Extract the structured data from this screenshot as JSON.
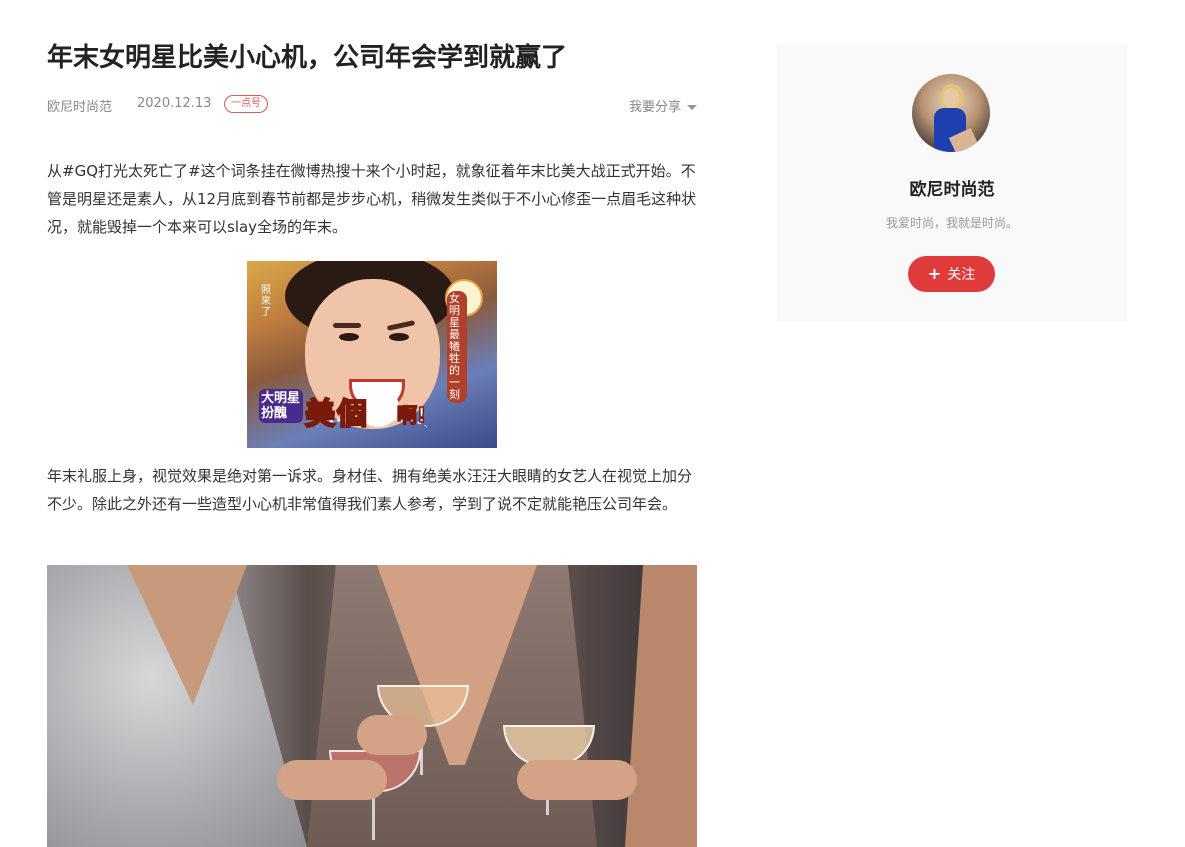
{
  "article": {
    "title": "年末女明星比美小心机，公司年会学到就赢了",
    "author": "欧尼时尚范",
    "date": "2020.12.13",
    "badge": "一点号",
    "share_label": "我要分享",
    "paragraphs": [
      "从#GQ打光太死亡了#这个词条挂在微博热搜十来个小时起，就象征着年末比美大战正式开始。不管是明星还是素人，从12月底到春节前都是步步心机，稍微发生类似于不小心修歪一点眉毛这种状况，就能毁掉一个本来可以slay全场的年末。",
      "年末礼服上身，视觉效果是绝对第一诉求。身材佳、拥有绝美水汪汪大眼睛的女艺人在视觉上加分不少。除此之外还有一些造型小心机非常值得我们素人参考，学到了说不定就能艳压公司年会。"
    ],
    "image1": {
      "caption_main": "美個",
      "caption_end": "啊!",
      "caption_badge": "大明星 扮醜",
      "side_left": "照來了",
      "side_right": "女明星最犧牲的一刻"
    }
  },
  "sidebar": {
    "name": "欧尼时尚范",
    "description": "我爱时尚，我就是时尚。",
    "follow_label": "关注",
    "follow_color": "#e03b3b"
  }
}
